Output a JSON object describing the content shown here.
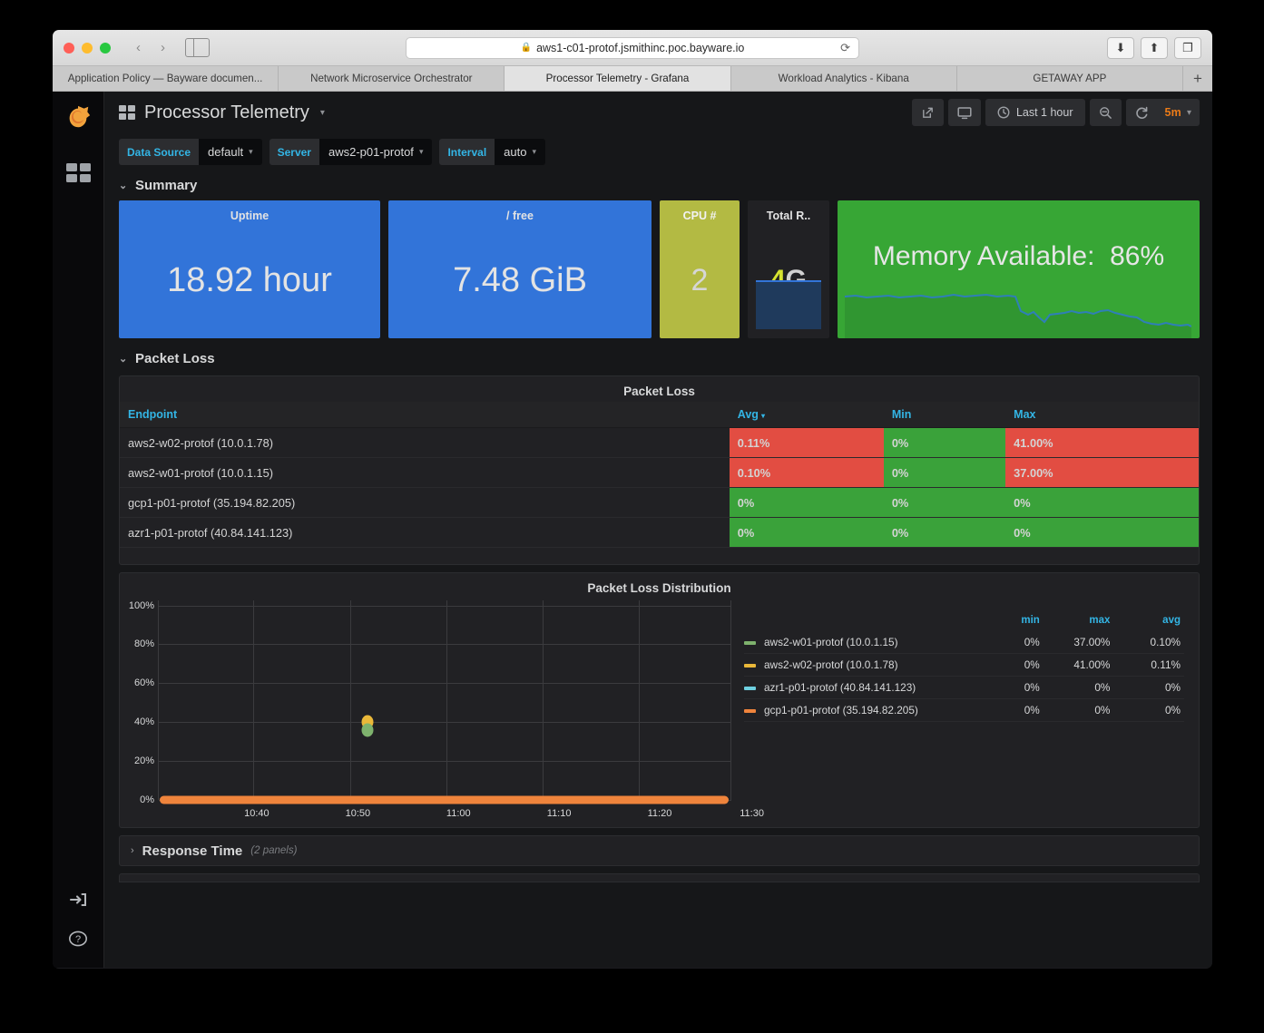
{
  "browser": {
    "url": "aws1-c01-protof.jsmithinc.poc.bayware.io",
    "lock_icon": "lock-icon",
    "reload_icon": "reload-icon",
    "back_icon": "back-chevron-icon",
    "forward_icon": "forward-chevron-icon",
    "sidebar_icon": "sidebar-toggle-icon",
    "download_icon": "download-icon",
    "share_icon": "share-icon",
    "tabs_overview_icon": "tab-overview-icon",
    "new_tab_label": "+",
    "tabs": [
      {
        "label": "Application Policy — Bayware documen...",
        "active": false
      },
      {
        "label": "Network Microservice Orchestrator",
        "active": false
      },
      {
        "label": "Processor Telemetry - Grafana",
        "active": true
      },
      {
        "label": "Workload Analytics - Kibana",
        "active": false
      },
      {
        "label": "GETAWAY APP",
        "active": false
      }
    ]
  },
  "sidenav": {
    "logo_icon": "grafana-logo-icon",
    "dashboards_icon": "dashboards-grid-icon",
    "signin_icon": "sign-in-icon",
    "help_icon": "help-question-icon"
  },
  "header": {
    "grid_icon": "dashboard-grid-icon",
    "title": "Processor Telemetry",
    "title_caret": "▾",
    "share_icon": "share-dashboard-icon",
    "tv_icon": "tv-mode-icon",
    "clock_icon": "clock-icon",
    "time_range": "Last 1 hour",
    "zoom_out_icon": "zoom-out-icon",
    "refresh_icon": "refresh-icon",
    "refresh_interval": "5m",
    "refresh_caret": "▾"
  },
  "variables": [
    {
      "label": "Data Source",
      "value": "default",
      "caret": "▾"
    },
    {
      "label": "Server",
      "value": "aws2-p01-protof",
      "caret": "▾"
    },
    {
      "label": "Interval",
      "value": "auto",
      "caret": "▾"
    }
  ],
  "rows": {
    "summary": {
      "label": "Summary",
      "chevron": "⌄",
      "expanded": true
    },
    "packet_loss": {
      "label": "Packet Loss",
      "chevron": "⌄",
      "expanded": true
    },
    "response_time": {
      "label": "Response Time",
      "chevron": "›",
      "sub": "(2 panels)",
      "expanded": false
    }
  },
  "stats": {
    "uptime": {
      "title": "Uptime",
      "value": "18.92 hour",
      "color": "#3274d9"
    },
    "free": {
      "title": "/ free",
      "value": "7.48 GiB",
      "color": "#3274d9"
    },
    "cpu": {
      "title": "CPU #",
      "value": "2",
      "color": "#b3ba43"
    },
    "total_ram": {
      "title": "Total R..",
      "value_num": "4",
      "value_unit": "G",
      "color": "#212124",
      "num_color": "#d6e330"
    },
    "memory": {
      "title": "Memory Available:",
      "value": "86%",
      "color": "#37a635"
    }
  },
  "packet_loss_table": {
    "panel_title": "Packet Loss",
    "columns": [
      {
        "label": "Endpoint",
        "sorted": false
      },
      {
        "label": "Avg",
        "sorted": true,
        "caret": "▾"
      },
      {
        "label": "Min",
        "sorted": false
      },
      {
        "label": "Max",
        "sorted": false
      }
    ],
    "rows": [
      {
        "endpoint": "aws2-w02-protof (10.0.1.78)",
        "avg": "0.11%",
        "avg_state": "red",
        "min": "0%",
        "min_state": "green",
        "max": "41.00%",
        "max_state": "red"
      },
      {
        "endpoint": "aws2-w01-protof (10.0.1.15)",
        "avg": "0.10%",
        "avg_state": "red",
        "min": "0%",
        "min_state": "green",
        "max": "37.00%",
        "max_state": "red"
      },
      {
        "endpoint": "gcp1-p01-protof (35.194.82.205)",
        "avg": "0%",
        "avg_state": "green",
        "min": "0%",
        "min_state": "green",
        "max": "0%",
        "max_state": "green"
      },
      {
        "endpoint": "azr1-p01-protof (40.84.141.123)",
        "avg": "0%",
        "avg_state": "green",
        "min": "0%",
        "min_state": "green",
        "max": "0%",
        "max_state": "green"
      }
    ]
  },
  "chart_data": {
    "type": "scatter",
    "title": "Packet Loss Distribution",
    "xlabel": "",
    "ylabel": "",
    "ylim": [
      0,
      100
    ],
    "ytick_labels": [
      "0%",
      "20%",
      "40%",
      "60%",
      "80%",
      "100%"
    ],
    "ytick_values": [
      0,
      20,
      40,
      60,
      80,
      100
    ],
    "xtick_labels": [
      "10:40",
      "10:50",
      "11:00",
      "11:10",
      "11:20",
      "11:30"
    ],
    "grid": true,
    "legend_position": "right",
    "series": [
      {
        "name": "aws2-w01-protof (10.0.1.15)",
        "color": "#7eb26d",
        "min": "0%",
        "max": "37.00%",
        "avg": "0.10%",
        "points": [
          {
            "x_label": "10:52",
            "x_frac": 0.365,
            "y": 37
          }
        ],
        "baseline_y": 0
      },
      {
        "name": "aws2-w02-protof (10.0.1.78)",
        "color": "#eab839",
        "min": "0%",
        "max": "41.00%",
        "avg": "0.11%",
        "points": [
          {
            "x_label": "10:52",
            "x_frac": 0.365,
            "y": 41
          }
        ],
        "baseline_y": 0
      },
      {
        "name": "azr1-p01-protof (40.84.141.123)",
        "color": "#6ed0e0",
        "min": "0%",
        "max": "0%",
        "avg": "0%",
        "points": [],
        "baseline_y": 0
      },
      {
        "name": "gcp1-p01-protof (35.194.82.205)",
        "color": "#ef843c",
        "min": "0%",
        "max": "0%",
        "avg": "0%",
        "points": [],
        "baseline_y": 0
      }
    ],
    "legend_headers": [
      "min",
      "max",
      "avg"
    ]
  }
}
